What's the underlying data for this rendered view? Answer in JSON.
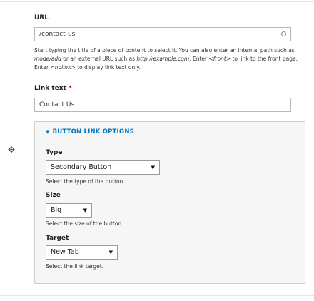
{
  "url": {
    "label": "URL",
    "value": "/contact-us",
    "description_parts": [
      "Start typing the title of a piece of content to select it. You can also enter an internal path such as ",
      "/node/add",
      " or an external URL such as ",
      "http://example.com",
      ". Enter ",
      "<front>",
      " to link to the front page. Enter ",
      "<nolink>",
      " to display link text only."
    ]
  },
  "link_text": {
    "label": "Link text",
    "required_mark": "*",
    "value": "Contact Us"
  },
  "button_link_options": {
    "legend": "BUTTON LINK OPTIONS",
    "toggle_glyph": "▼",
    "type": {
      "label": "Type",
      "value": "Secondary Button",
      "description": "Select the type of the button."
    },
    "size": {
      "label": "Size",
      "value": "Big",
      "description": "Select the size of the button."
    },
    "target": {
      "label": "Target",
      "value": "New Tab",
      "description": "Select the link target."
    }
  },
  "icons": {
    "drag_handle": "✥",
    "select_caret": "▼"
  }
}
